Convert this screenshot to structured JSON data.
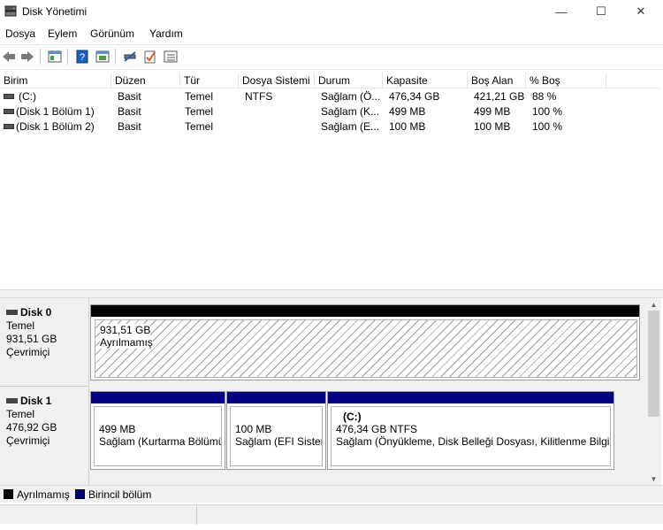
{
  "window": {
    "title": "Disk Yönetimi",
    "minimize_glyph": "—",
    "maximize_glyph": "☐",
    "close_glyph": "✕"
  },
  "menu": [
    "Dosya",
    "Eylem",
    "Görünüm",
    "Yardım"
  ],
  "toolbar": [
    "back-arrow-icon",
    "forward-arrow-icon",
    "properties-icon",
    "help-icon",
    "view-icon",
    "connect-icon",
    "check-icon",
    "list-icon"
  ],
  "volume_list": {
    "columns": [
      "Birim",
      "Düzen",
      "Tür",
      "Dosya Sistemi",
      "Durum",
      "Kapasite",
      "Boş Alan",
      "% Boş"
    ],
    "rows": [
      [
        "(C:)",
        "Basit",
        "Temel",
        "NTFS",
        "Sağlam (Ö...",
        "476,34 GB",
        "421,21 GB",
        "88 %"
      ],
      [
        "(Disk 1 Bölüm 1)",
        "Basit",
        "Temel",
        "",
        "Sağlam (K...",
        "499 MB",
        "499 MB",
        "100 %"
      ],
      [
        "(Disk 1 Bölüm 2)",
        "Basit",
        "Temel",
        "",
        "Sağlam (E...",
        "100 MB",
        "100 MB",
        "100 %"
      ]
    ]
  },
  "disks": [
    {
      "name": "Disk 0",
      "type": "Temel",
      "size": "931,51 GB",
      "status": "Çevrimiçi",
      "partitions": [
        {
          "size": "931,51 GB",
          "label": "Ayrılmamış",
          "kind": "unallocated"
        }
      ]
    },
    {
      "name": "Disk 1",
      "type": "Temel",
      "size": "476,92 GB",
      "status": "Çevrimiçi",
      "partitions": [
        {
          "title": "",
          "size": "499 MB",
          "label": "Sağlam (Kurtarma Bölümü)",
          "kind": "primary"
        },
        {
          "title": "",
          "size": "100 MB",
          "label": "Sağlam (EFI Sistem Bölümü)",
          "kind": "primary"
        },
        {
          "title": "(C:)",
          "size": "476,34 GB NTFS",
          "label": "Sağlam (Önyükleme, Disk Belleği Dosyası, Kilitlenme Bilgisi, Birincil Bölüm)",
          "kind": "primary"
        }
      ]
    }
  ],
  "legend": [
    {
      "label": "Ayrılmamış",
      "color": "#000000"
    },
    {
      "label": "Birincil bölüm",
      "color": "#000080"
    }
  ],
  "colors": {
    "primary": "#000080",
    "unallocated": "#000000"
  }
}
